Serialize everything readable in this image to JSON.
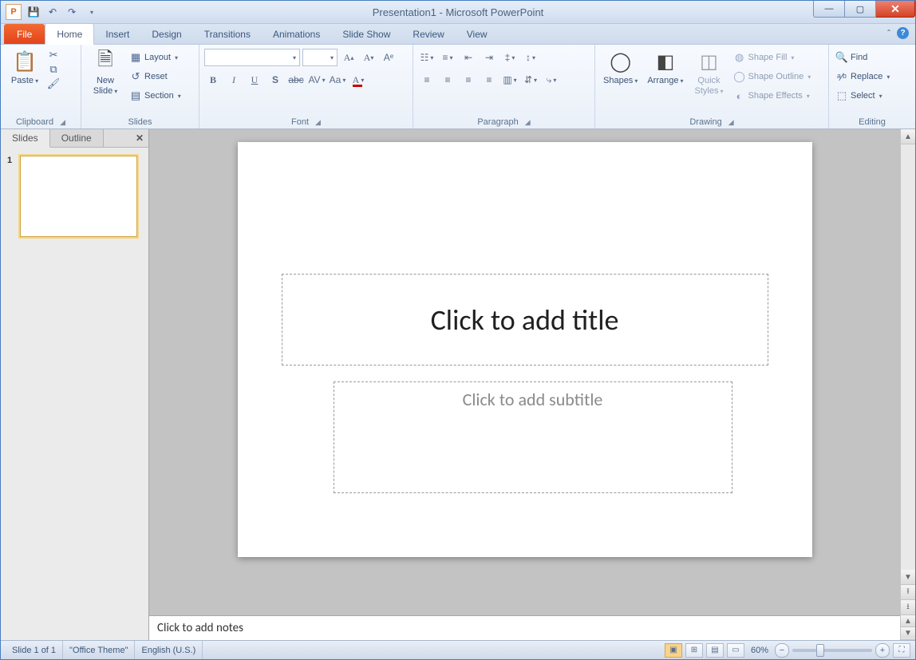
{
  "window": {
    "title": "Presentation1 - Microsoft PowerPoint"
  },
  "tabs": {
    "file": "File",
    "home": "Home",
    "insert": "Insert",
    "design": "Design",
    "transitions": "Transitions",
    "animations": "Animations",
    "slideshow": "Slide Show",
    "review": "Review",
    "view": "View"
  },
  "ribbon": {
    "clipboard": {
      "label": "Clipboard",
      "paste": "Paste"
    },
    "slides": {
      "label": "Slides",
      "new_slide": "New\nSlide",
      "layout": "Layout",
      "reset": "Reset",
      "section": "Section"
    },
    "font": {
      "label": "Font"
    },
    "paragraph": {
      "label": "Paragraph"
    },
    "drawing": {
      "label": "Drawing",
      "shapes": "Shapes",
      "arrange": "Arrange",
      "quick_styles": "Quick\nStyles",
      "shape_fill": "Shape Fill",
      "shape_outline": "Shape Outline",
      "shape_effects": "Shape Effects"
    },
    "editing": {
      "label": "Editing",
      "find": "Find",
      "replace": "Replace",
      "select": "Select"
    }
  },
  "left_pane": {
    "slides_tab": "Slides",
    "outline_tab": "Outline",
    "thumb_number": "1"
  },
  "slide": {
    "title_placeholder": "Click to add title",
    "subtitle_placeholder": "Click to add subtitle"
  },
  "notes": {
    "placeholder": "Click to add notes"
  },
  "statusbar": {
    "slide_info": "Slide 1 of 1",
    "theme": "\"Office Theme\"",
    "language": "English (U.S.)",
    "zoom": "60%"
  }
}
